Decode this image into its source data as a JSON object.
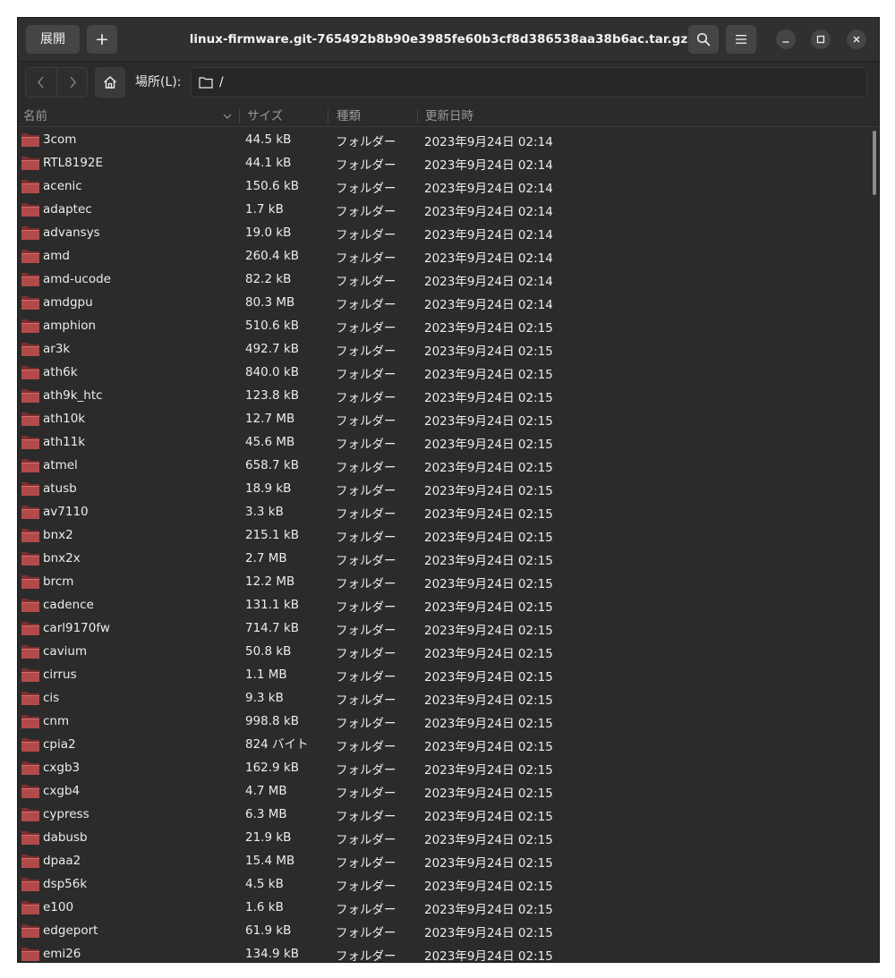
{
  "header": {
    "extract_label": "展開",
    "add_label": "+",
    "title": "linux-firmware.git-765492b8b90e3985fe60b3cf8d386538aa38b6ac.tar.gz"
  },
  "location": {
    "label": "場所(L):",
    "path": "/"
  },
  "columns": {
    "name": "名前",
    "size": "サイズ",
    "type": "種類",
    "date": "更新日時"
  },
  "colors": {
    "folder_body": "#b34a4a",
    "folder_tab": "#7d2f2f",
    "window_bg": "#2b2b2b"
  },
  "rows": [
    {
      "name": "3com",
      "size": "44.5 kB",
      "type": "フォルダー",
      "date": "2023年9月24日 02:14"
    },
    {
      "name": "RTL8192E",
      "size": "44.1 kB",
      "type": "フォルダー",
      "date": "2023年9月24日 02:14"
    },
    {
      "name": "acenic",
      "size": "150.6 kB",
      "type": "フォルダー",
      "date": "2023年9月24日 02:14"
    },
    {
      "name": "adaptec",
      "size": "1.7 kB",
      "type": "フォルダー",
      "date": "2023年9月24日 02:14"
    },
    {
      "name": "advansys",
      "size": "19.0 kB",
      "type": "フォルダー",
      "date": "2023年9月24日 02:14"
    },
    {
      "name": "amd",
      "size": "260.4 kB",
      "type": "フォルダー",
      "date": "2023年9月24日 02:14"
    },
    {
      "name": "amd-ucode",
      "size": "82.2 kB",
      "type": "フォルダー",
      "date": "2023年9月24日 02:14"
    },
    {
      "name": "amdgpu",
      "size": "80.3 MB",
      "type": "フォルダー",
      "date": "2023年9月24日 02:14"
    },
    {
      "name": "amphion",
      "size": "510.6 kB",
      "type": "フォルダー",
      "date": "2023年9月24日 02:15"
    },
    {
      "name": "ar3k",
      "size": "492.7 kB",
      "type": "フォルダー",
      "date": "2023年9月24日 02:15"
    },
    {
      "name": "ath6k",
      "size": "840.0 kB",
      "type": "フォルダー",
      "date": "2023年9月24日 02:15"
    },
    {
      "name": "ath9k_htc",
      "size": "123.8 kB",
      "type": "フォルダー",
      "date": "2023年9月24日 02:15"
    },
    {
      "name": "ath10k",
      "size": "12.7 MB",
      "type": "フォルダー",
      "date": "2023年9月24日 02:15"
    },
    {
      "name": "ath11k",
      "size": "45.6 MB",
      "type": "フォルダー",
      "date": "2023年9月24日 02:15"
    },
    {
      "name": "atmel",
      "size": "658.7 kB",
      "type": "フォルダー",
      "date": "2023年9月24日 02:15"
    },
    {
      "name": "atusb",
      "size": "18.9 kB",
      "type": "フォルダー",
      "date": "2023年9月24日 02:15"
    },
    {
      "name": "av7110",
      "size": "3.3 kB",
      "type": "フォルダー",
      "date": "2023年9月24日 02:15"
    },
    {
      "name": "bnx2",
      "size": "215.1 kB",
      "type": "フォルダー",
      "date": "2023年9月24日 02:15"
    },
    {
      "name": "bnx2x",
      "size": "2.7 MB",
      "type": "フォルダー",
      "date": "2023年9月24日 02:15"
    },
    {
      "name": "brcm",
      "size": "12.2 MB",
      "type": "フォルダー",
      "date": "2023年9月24日 02:15"
    },
    {
      "name": "cadence",
      "size": "131.1 kB",
      "type": "フォルダー",
      "date": "2023年9月24日 02:15"
    },
    {
      "name": "carl9170fw",
      "size": "714.7 kB",
      "type": "フォルダー",
      "date": "2023年9月24日 02:15"
    },
    {
      "name": "cavium",
      "size": "50.8 kB",
      "type": "フォルダー",
      "date": "2023年9月24日 02:15"
    },
    {
      "name": "cirrus",
      "size": "1.1 MB",
      "type": "フォルダー",
      "date": "2023年9月24日 02:15"
    },
    {
      "name": "cis",
      "size": "9.3 kB",
      "type": "フォルダー",
      "date": "2023年9月24日 02:15"
    },
    {
      "name": "cnm",
      "size": "998.8 kB",
      "type": "フォルダー",
      "date": "2023年9月24日 02:15"
    },
    {
      "name": "cpia2",
      "size": "824 バイト",
      "type": "フォルダー",
      "date": "2023年9月24日 02:15"
    },
    {
      "name": "cxgb3",
      "size": "162.9 kB",
      "type": "フォルダー",
      "date": "2023年9月24日 02:15"
    },
    {
      "name": "cxgb4",
      "size": "4.7 MB",
      "type": "フォルダー",
      "date": "2023年9月24日 02:15"
    },
    {
      "name": "cypress",
      "size": "6.3 MB",
      "type": "フォルダー",
      "date": "2023年9月24日 02:15"
    },
    {
      "name": "dabusb",
      "size": "21.9 kB",
      "type": "フォルダー",
      "date": "2023年9月24日 02:15"
    },
    {
      "name": "dpaa2",
      "size": "15.4 MB",
      "type": "フォルダー",
      "date": "2023年9月24日 02:15"
    },
    {
      "name": "dsp56k",
      "size": "4.5 kB",
      "type": "フォルダー",
      "date": "2023年9月24日 02:15"
    },
    {
      "name": "e100",
      "size": "1.6 kB",
      "type": "フォルダー",
      "date": "2023年9月24日 02:15"
    },
    {
      "name": "edgeport",
      "size": "61.9 kB",
      "type": "フォルダー",
      "date": "2023年9月24日 02:15"
    },
    {
      "name": "emi26",
      "size": "134.9 kB",
      "type": "フォルダー",
      "date": "2023年9月24日 02:15"
    }
  ]
}
